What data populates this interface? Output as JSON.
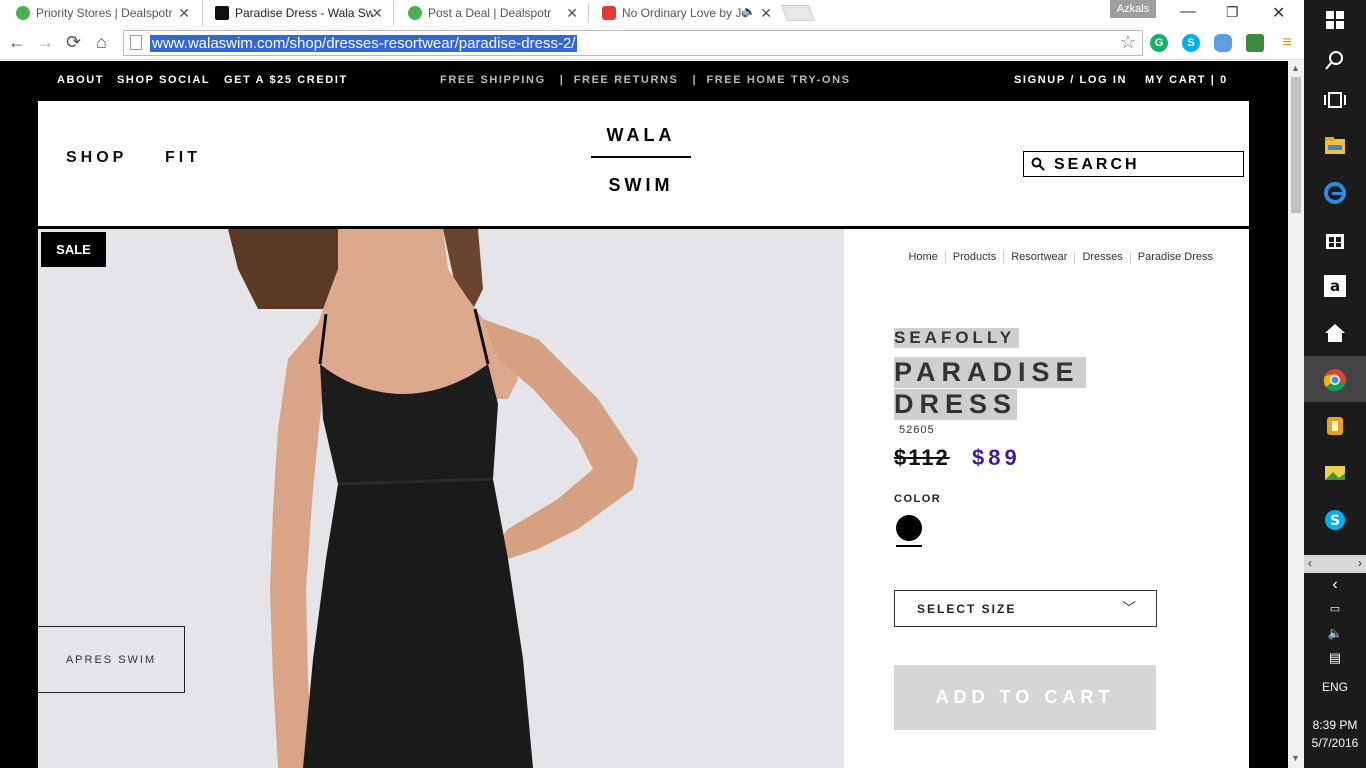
{
  "browser": {
    "tabs": [
      {
        "label": "Priority Stores | Dealspotr",
        "active": false
      },
      {
        "label": "Paradise Dress - Wala Swim",
        "active": true
      },
      {
        "label": "Post a Deal | Dealspotr",
        "active": false
      },
      {
        "label": "No Ordinary Love by Je",
        "active": false
      }
    ],
    "profile_name": "Azkals",
    "url": "www.walaswim.com/shop/dresses-resortwear/paradise-dress-2/"
  },
  "topbar": {
    "about": "ABOUT",
    "shop_social": "SHOP SOCIAL",
    "credit": "GET A $25 CREDIT",
    "promo": "FREE SHIPPING   |  FREE RETURNS   |  FREE HOME TRY-ONS",
    "signup": "SIGNUP / LOG IN",
    "cart": "MY CART | 0"
  },
  "header": {
    "nav": [
      "SHOP",
      "FIT"
    ],
    "logo_top": "WALA",
    "logo_bottom": "SWIM",
    "search_label": "SEARCH"
  },
  "product_image": {
    "sale_badge": "SALE",
    "category_tag": "APRES SWIM"
  },
  "product": {
    "breadcrumb": [
      "Home",
      "Products",
      "Resortwear",
      "Dresses",
      "Paradise Dress"
    ],
    "brand": "SEAFOLLY",
    "title_line1": "PARADISE",
    "title_line2": "DRESS",
    "sku": "52605",
    "old_price": "$112",
    "sale_price": "$89",
    "color_label": "COLOR",
    "swatch_color": "#000000",
    "size_select": "SELECT SIZE",
    "add_to_cart": "ADD TO CART",
    "price_color": "#3a1f9a"
  },
  "system_tray": {
    "language": "ENG",
    "time": "8:39 PM",
    "date": "5/7/2016"
  }
}
